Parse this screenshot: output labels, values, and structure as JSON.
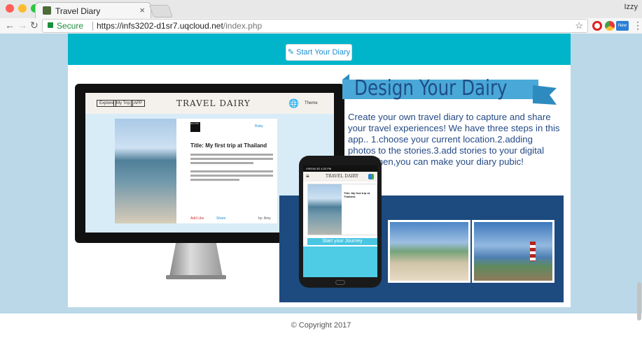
{
  "browser": {
    "tab_title": "Travel Diary",
    "tab_close": "×",
    "profile": "Izzy",
    "secure_label": "Secure",
    "url_scheme_host": "https://infs3202-d1sr7.uqcloud.net",
    "url_path": "/index.php",
    "new_badge": "New",
    "colors": {
      "secure": "#1a8f3c",
      "close_light": "#fe5f57",
      "min_light": "#febc2e",
      "max_light": "#28c840"
    },
    "icons": [
      "back-arrow-icon",
      "forward-arrow-icon",
      "reload-icon",
      "lock-icon",
      "bookmark-star-icon",
      "opera-icon",
      "chrome-ext-icon",
      "new-ext-icon",
      "menu-dots-icon"
    ]
  },
  "page": {
    "start_button": "Start Your Diary",
    "banner_title": "Design Your Dairy",
    "description": "Create your own travel diary to capture and share your travel experiences! We have three steps in this app.. 1.choose your current location.2.adding photos to the stories.3.add stories to your digital diary. Then,you can make your diary pubic!",
    "colors": {
      "accent_bar": "#00b5c9",
      "banner": "#4aa8d8",
      "title": "#1e4f86",
      "navy": "#1d4a7f"
    }
  },
  "mockup": {
    "monitor_nav": [
      "Explore",
      "My Trip",
      "APP"
    ],
    "monitor_logo": "TRAVEL DAIRY",
    "monitor_theme": "Theme",
    "monitor_ruby": "Ruby",
    "monitor_date": "Jun 17th",
    "monitor_post_title": "Title: My first trip at Thailand",
    "monitor_like": "Add Like",
    "monitor_share": "Share",
    "monitor_by": "by: Amy",
    "phone_status": "VIRGIN 3G 4:20 PM",
    "phone_logo": "TRAVEL DAIRY",
    "phone_post_title": "Title: My first trip at Thailand",
    "phone_journey": "Start your Journey"
  },
  "footer": {
    "copyright": "© Copyright 2017"
  }
}
